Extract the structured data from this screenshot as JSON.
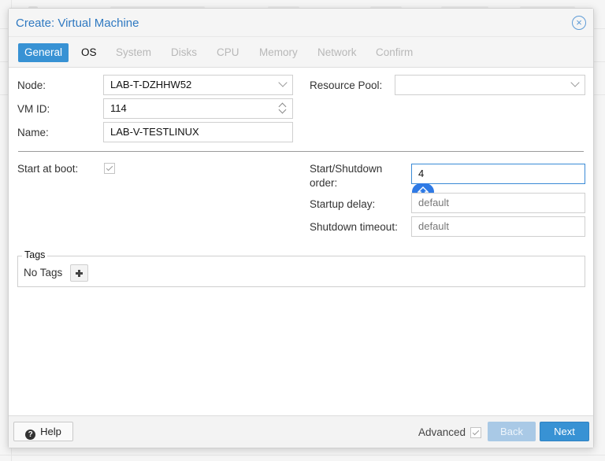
{
  "dialog": {
    "title": "Create: Virtual Machine"
  },
  "tabs": [
    {
      "label": "General",
      "state": "active"
    },
    {
      "label": "OS",
      "state": "enabled"
    },
    {
      "label": "System",
      "state": "disabled"
    },
    {
      "label": "Disks",
      "state": "disabled"
    },
    {
      "label": "CPU",
      "state": "disabled"
    },
    {
      "label": "Memory",
      "state": "disabled"
    },
    {
      "label": "Network",
      "state": "disabled"
    },
    {
      "label": "Confirm",
      "state": "disabled"
    }
  ],
  "general": {
    "node_label": "Node:",
    "node_value": "LAB-T-DZHHW52",
    "vmid_label": "VM ID:",
    "vmid_value": "114",
    "name_label": "Name:",
    "name_value": "LAB-V-TESTLINUX",
    "resource_pool_label": "Resource Pool:",
    "resource_pool_value": "",
    "start_at_boot_label": "Start at boot:",
    "start_at_boot_checked": true,
    "start_order_label_line1": "Start/Shutdown",
    "start_order_label_line2": "order:",
    "start_order_value": "4",
    "startup_delay_label": "Startup delay:",
    "startup_delay_placeholder": "default",
    "shutdown_timeout_label": "Shutdown timeout:",
    "shutdown_timeout_placeholder": "default"
  },
  "tags": {
    "legend": "Tags",
    "empty_text": "No Tags"
  },
  "footer": {
    "help_label": "Help",
    "advanced_label": "Advanced",
    "advanced_checked": true,
    "back_label": "Back",
    "next_label": "Next"
  },
  "colors": {
    "accent": "#3892d4",
    "title": "#2f79c1",
    "caps_lock_badge": "#2f7ae5"
  },
  "icons": [
    "close-icon",
    "chevron-down-icon",
    "spinner-icon",
    "checkmark-icon",
    "caps-lock-icon",
    "plus-icon",
    "help-icon"
  ]
}
